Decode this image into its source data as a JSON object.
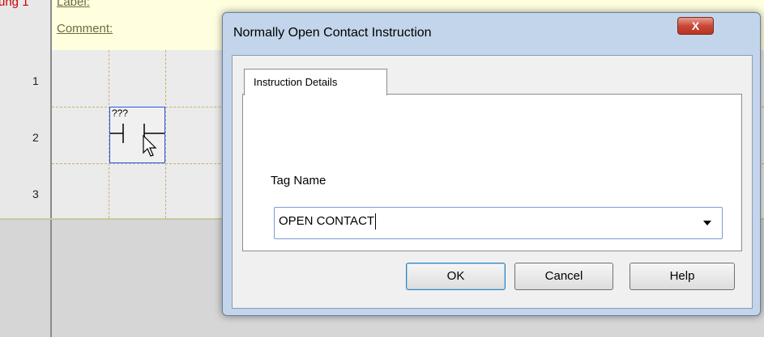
{
  "ladder": {
    "rung_label": "ung 1",
    "label_link": "Label:",
    "comment_link": "Comment:",
    "row_numbers": [
      "1",
      "2",
      "3"
    ],
    "contact_tag": "???"
  },
  "dialog": {
    "title": "Normally Open Contact Instruction",
    "close_label": "X",
    "tab_label": "Instruction Details",
    "tag_name_label": "Tag Name",
    "tag_name_value": "OPEN CONTACT",
    "ok_label": "OK",
    "cancel_label": "Cancel",
    "help_label": "Help"
  },
  "icons": {
    "close": "close-icon",
    "combo": "chevron-down-icon",
    "cursor": "mouse-pointer-icon",
    "contact": "normally-open-contact-icon"
  },
  "colors": {
    "rung_label": "#cc0000",
    "selection": "#2255ff",
    "close_button": "#c9483a",
    "dialog_frame": "#c3d5ea"
  }
}
